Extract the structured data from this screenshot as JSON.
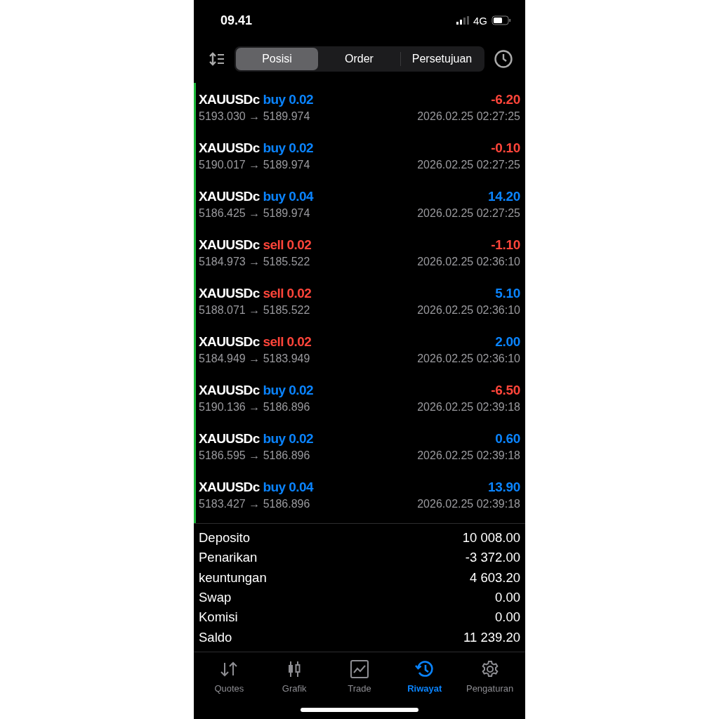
{
  "status_bar": {
    "time": "09.41",
    "network": "4G"
  },
  "toolbar": {
    "tabs": [
      {
        "label": "Posisi",
        "selected": true
      },
      {
        "label": "Order",
        "selected": false
      },
      {
        "label": "Persetujuan",
        "selected": false
      }
    ]
  },
  "trades": [
    {
      "symbol": "XAUUSDc",
      "kind": "buy",
      "order": "buy 0.02",
      "prices": "5193.030 → 5189.974",
      "time": "2026.02.25 02:27:25",
      "profit": "-6.20",
      "color": "#ff453a"
    },
    {
      "symbol": "XAUUSDc",
      "kind": "buy",
      "order": "buy 0.02",
      "prices": "5190.017 → 5189.974",
      "time": "2026.02.25 02:27:25",
      "profit": "-0.10",
      "color": "#ff453a"
    },
    {
      "symbol": "XAUUSDc",
      "kind": "buy",
      "order": "buy 0.04",
      "prices": "5186.425 → 5189.974",
      "time": "2026.02.25 02:27:25",
      "profit": "14.20",
      "color": "#0a84ff"
    },
    {
      "symbol": "XAUUSDc",
      "kind": "sell",
      "order": "sell 0.02",
      "prices": "5184.973 → 5185.522",
      "time": "2026.02.25 02:36:10",
      "profit": "-1.10",
      "color": "#ff453a"
    },
    {
      "symbol": "XAUUSDc",
      "kind": "sell",
      "order": "sell 0.02",
      "prices": "5188.071 → 5185.522",
      "time": "2026.02.25 02:36:10",
      "profit": "5.10",
      "color": "#0a84ff"
    },
    {
      "symbol": "XAUUSDc",
      "kind": "sell",
      "order": "sell 0.02",
      "prices": "5184.949 → 5183.949",
      "time": "2026.02.25 02:36:10",
      "profit": "2.00",
      "color": "#0a84ff"
    },
    {
      "symbol": "XAUUSDc",
      "kind": "buy",
      "order": "buy 0.02",
      "prices": "5190.136 → 5186.896",
      "time": "2026.02.25 02:39:18",
      "profit": "-6.50",
      "color": "#ff453a"
    },
    {
      "symbol": "XAUUSDc",
      "kind": "buy",
      "order": "buy 0.02",
      "prices": "5186.595 → 5186.896",
      "time": "2026.02.25 02:39:18",
      "profit": "0.60",
      "color": "#0a84ff"
    },
    {
      "symbol": "XAUUSDc",
      "kind": "buy",
      "order": "buy 0.04",
      "prices": "5183.427 → 5186.896",
      "time": "2026.02.25 02:39:18",
      "profit": "13.90",
      "color": "#0a84ff"
    }
  ],
  "summary": [
    {
      "label": "Deposito",
      "value": "10 008.00"
    },
    {
      "label": "Penarikan",
      "value": "-3 372.00"
    },
    {
      "label": "keuntungan",
      "value": "4 603.20"
    },
    {
      "label": "Swap",
      "value": "0.00"
    },
    {
      "label": "Komisi",
      "value": "0.00"
    },
    {
      "label": "Saldo",
      "value": "11 239.20"
    }
  ],
  "tab_bar": [
    {
      "kind": "quotes",
      "label": "Quotes",
      "selected": false
    },
    {
      "kind": "chart",
      "label": "Grafik",
      "selected": false
    },
    {
      "kind": "trade",
      "label": "Trade",
      "selected": false
    },
    {
      "kind": "history",
      "label": "Riwayat",
      "selected": true
    },
    {
      "kind": "settings",
      "label": "Pengaturan",
      "selected": false
    }
  ]
}
